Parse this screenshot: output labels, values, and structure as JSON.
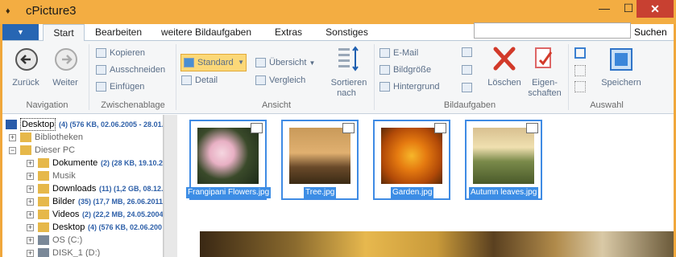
{
  "window": {
    "title": "cPicture3",
    "app_symbol": "♦",
    "min": "—",
    "max": "☐",
    "close": "✕"
  },
  "tabs": {
    "file_button": "▼",
    "start": "Start",
    "bearbeiten": "Bearbeiten",
    "weitere": "weitere Bildaufgaben",
    "extras": "Extras",
    "sonstiges": "Sonstiges"
  },
  "search": {
    "button": "Suchen",
    "placeholder": ""
  },
  "ribbon": {
    "navigation": {
      "label": "Navigation",
      "back": "Zurück",
      "forward": "Weiter"
    },
    "clipboard": {
      "label": "Zwischenablage",
      "copy": "Kopieren",
      "cut": "Ausschneiden",
      "paste": "Einfügen"
    },
    "view": {
      "label": "Ansicht",
      "standard": "Standard",
      "detail": "Detail",
      "overview": "Übersicht",
      "compare": "Vergleich",
      "sort": "Sortieren",
      "sort2": "nach"
    },
    "image_tasks": {
      "label": "Bildaufgaben",
      "email": "E-Mail",
      "size": "Bildgröße",
      "background": "Hintergrund",
      "delete": "Löschen",
      "props1": "Eigen-",
      "props2": "schaften"
    },
    "selection": {
      "label": "Auswahl",
      "save": "Speichern"
    }
  },
  "tree": [
    {
      "name": "Desktop",
      "info": "(4) (576 KB, 02.06.2005 - 28.01.",
      "level": 0,
      "expander": "",
      "selected": true
    },
    {
      "name": "Bibliotheken",
      "info": "",
      "level": 1,
      "expander": "+",
      "selected": false
    },
    {
      "name": "Dieser PC",
      "info": "",
      "level": 1,
      "expander": "−",
      "selected": false
    },
    {
      "name": "Dokumente",
      "info": "(2) (28 KB, 19.10.2",
      "level": 2,
      "expander": "+",
      "selected": false
    },
    {
      "name": "Musik",
      "info": "",
      "level": 2,
      "expander": "+",
      "selected": false
    },
    {
      "name": "Downloads",
      "info": "(11) (1,2 GB, 08.12.",
      "level": 2,
      "expander": "+",
      "selected": false
    },
    {
      "name": "Bilder",
      "info": "(35) (17,7 MB, 26.06.2011",
      "level": 2,
      "expander": "+",
      "selected": false
    },
    {
      "name": "Videos",
      "info": "(2) (22,2 MB, 24.05.2004",
      "level": 2,
      "expander": "+",
      "selected": false
    },
    {
      "name": "Desktop",
      "info": "(4) (576 KB, 02.06.200",
      "level": 2,
      "expander": "+",
      "selected": false
    },
    {
      "name": "OS (C:)",
      "info": "",
      "level": 2,
      "expander": "+",
      "selected": false
    },
    {
      "name": "DISK_1 (D:)",
      "info": "",
      "level": 2,
      "expander": "+",
      "selected": false
    }
  ],
  "thumbnails": [
    {
      "caption": "Frangipani Flowers.jpg"
    },
    {
      "caption": "Tree.jpg"
    },
    {
      "caption": "Garden.jpg"
    },
    {
      "caption": "Autumn leaves.jpg"
    }
  ],
  "colors": {
    "titlebar": "#f3ad42",
    "selection": "#3c8de5",
    "close": "#c84031"
  }
}
